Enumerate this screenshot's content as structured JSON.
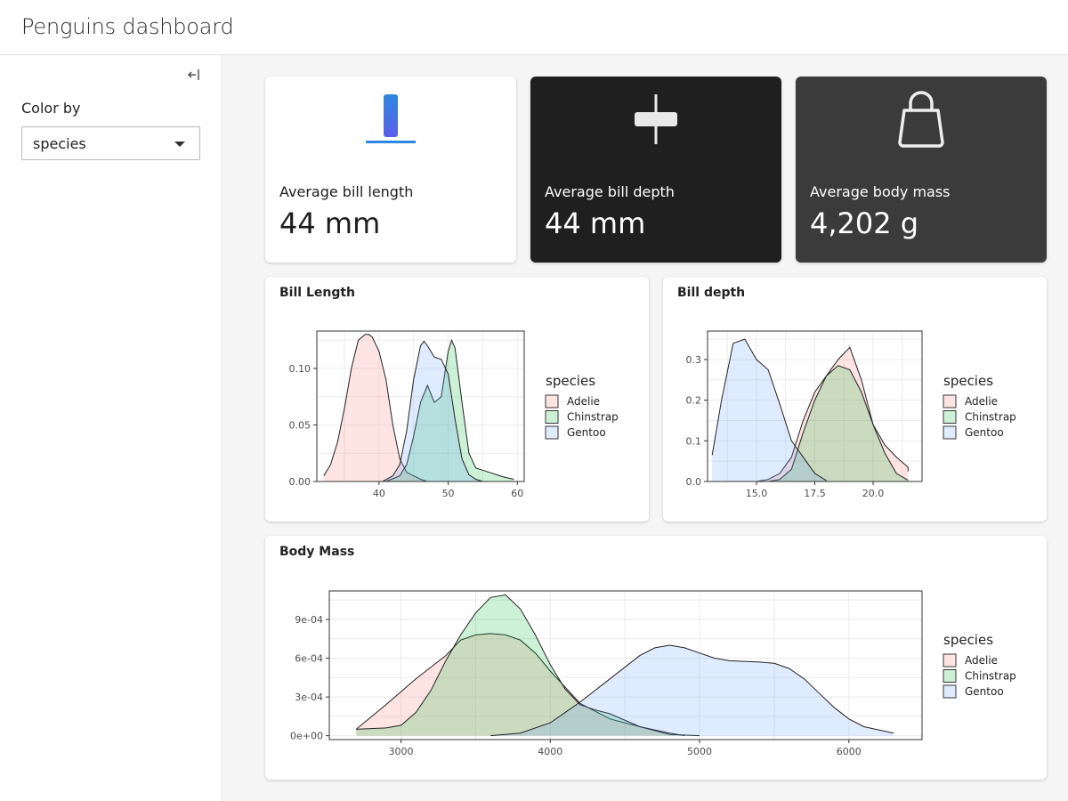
{
  "header": {
    "title": "Penguins dashboard"
  },
  "sidebar": {
    "collapse_icon": "collapse-left-icon",
    "color_by_label": "Color by",
    "color_by_value": "species"
  },
  "value_boxes": [
    {
      "title": "Average bill length",
      "value": "44 mm",
      "icon": "ruler-vertical-icon"
    },
    {
      "title": "Average bill depth",
      "value": "44 mm",
      "icon": "ruler-horizontal-icon"
    },
    {
      "title": "Average body mass",
      "value": "4,202 g",
      "icon": "shopping-bag-icon"
    }
  ],
  "colors": {
    "Adelie": "#F8766D",
    "Chinstrap": "#00BA38",
    "Gentoo": "#619CFF"
  },
  "cards": [
    {
      "title": "Bill Length"
    },
    {
      "title": "Bill depth"
    },
    {
      "title": "Body Mass"
    }
  ],
  "chart_data": [
    {
      "type": "area",
      "title": "Bill Length",
      "legend_title": "species",
      "legend": "right",
      "xlim": [
        31,
        61
      ],
      "ylim": [
        0,
        0.133
      ],
      "xticks": [
        40,
        50,
        60
      ],
      "yticks": [
        0.0,
        0.05,
        0.1
      ],
      "ytick_labels": [
        "0.00",
        "0.05",
        "0.10"
      ],
      "grid": true,
      "series": [
        {
          "name": "Adelie",
          "x": [
            32,
            33,
            34,
            35,
            36,
            37,
            38,
            38.5,
            39,
            40,
            41,
            42,
            43,
            44,
            45,
            46,
            47
          ],
          "y": [
            0.005,
            0.015,
            0.035,
            0.065,
            0.1,
            0.125,
            0.13,
            0.13,
            0.128,
            0.115,
            0.09,
            0.05,
            0.02,
            0.008,
            0.005,
            0.002,
            0
          ]
        },
        {
          "name": "Chinstrap",
          "x": [
            41,
            43,
            44,
            45,
            46,
            47,
            48,
            49,
            50,
            50.5,
            51,
            52,
            53,
            54,
            55,
            56,
            57,
            58,
            59.5
          ],
          "y": [
            0,
            0.005,
            0.015,
            0.04,
            0.07,
            0.085,
            0.07,
            0.075,
            0.115,
            0.125,
            0.118,
            0.07,
            0.025,
            0.012,
            0.01,
            0.008,
            0.006,
            0.004,
            0.002
          ]
        },
        {
          "name": "Gentoo",
          "x": [
            40.5,
            42,
            43,
            44,
            45,
            46,
            46.5,
            47,
            48,
            49,
            50,
            51,
            52,
            53,
            54,
            55
          ],
          "y": [
            0,
            0.005,
            0.015,
            0.045,
            0.09,
            0.12,
            0.124,
            0.12,
            0.11,
            0.108,
            0.095,
            0.055,
            0.02,
            0.006,
            0.002,
            0
          ]
        }
      ]
    },
    {
      "type": "area",
      "title": "Bill depth",
      "legend_title": "species",
      "legend": "right",
      "xlim": [
        12.9,
        22.1
      ],
      "ylim": [
        0,
        0.37
      ],
      "xticks": [
        15.0,
        17.5,
        20.0
      ],
      "xtick_labels": [
        "15.0",
        "17.5",
        "20.0"
      ],
      "yticks": [
        0.0,
        0.1,
        0.2,
        0.3
      ],
      "ytick_labels": [
        "0.0",
        "0.1",
        "0.2",
        "0.3"
      ],
      "grid": true,
      "series": [
        {
          "name": "Adelie",
          "x": [
            15,
            15.5,
            16,
            16.5,
            17,
            17.5,
            18,
            18.5,
            19,
            19.5,
            20,
            20.5,
            21,
            21.5,
            21.5
          ],
          "y": [
            0,
            0.005,
            0.02,
            0.06,
            0.15,
            0.22,
            0.26,
            0.3,
            0.33,
            0.25,
            0.14,
            0.09,
            0.06,
            0.035,
            0.025
          ]
        },
        {
          "name": "Chinstrap",
          "x": [
            15.5,
            16,
            16.5,
            17,
            17.5,
            18,
            18.5,
            19,
            19.5,
            20,
            20.5,
            21,
            21.5
          ],
          "y": [
            0,
            0.005,
            0.03,
            0.12,
            0.2,
            0.26,
            0.285,
            0.275,
            0.22,
            0.14,
            0.07,
            0.02,
            0.003
          ]
        },
        {
          "name": "Gentoo",
          "x": [
            13.1,
            13.5,
            14,
            14.5,
            15,
            15.5,
            16,
            16.5,
            17,
            17.5,
            18
          ],
          "y": [
            0.065,
            0.2,
            0.34,
            0.35,
            0.3,
            0.275,
            0.19,
            0.1,
            0.06,
            0.02,
            0.002
          ]
        }
      ]
    },
    {
      "type": "area",
      "title": "Body Mass",
      "legend_title": "species",
      "legend": "right",
      "xlim": [
        2520,
        6490
      ],
      "ylim": [
        -3e-05,
        0.00112
      ],
      "xticks": [
        3000,
        4000,
        5000,
        6000
      ],
      "yticks": [
        0.0,
        0.0003,
        0.0006,
        0.0009
      ],
      "ytick_labels": [
        "0e+00",
        "3e-04",
        "6e-04",
        "9e-04"
      ],
      "grid": true,
      "series": [
        {
          "name": "Adelie",
          "x": [
            2700,
            2900,
            3100,
            3300,
            3400,
            3500,
            3600,
            3700,
            3800,
            3900,
            4000,
            4200,
            4400,
            4600,
            4800,
            4900
          ],
          "y": [
            5e-05,
            0.00024,
            0.00044,
            0.00062,
            0.00074,
            0.00078,
            0.00079,
            0.00078,
            0.00074,
            0.00064,
            0.0005,
            0.00025,
            0.00013,
            7e-05,
            2e-05,
            0
          ]
        },
        {
          "name": "Chinstrap",
          "x": [
            2700,
            2900,
            3000,
            3100,
            3200,
            3300,
            3400,
            3500,
            3600,
            3700,
            3800,
            3900,
            4000,
            4100,
            4200,
            4300,
            4400,
            4600,
            4800,
            5000
          ],
          "y": [
            5e-05,
            6e-05,
            8e-05,
            0.00018,
            0.00035,
            0.00058,
            0.00078,
            0.00095,
            0.00107,
            0.00109,
            0.00098,
            0.00078,
            0.00055,
            0.00036,
            0.00024,
            0.0002,
            0.00017,
            7e-05,
            1e-05,
            0
          ]
        },
        {
          "name": "Gentoo",
          "x": [
            3600,
            3800,
            4000,
            4200,
            4400,
            4600,
            4700,
            4800,
            4900,
            5000,
            5100,
            5200,
            5400,
            5500,
            5600,
            5700,
            5800,
            5900,
            6000,
            6100,
            6300
          ],
          "y": [
            0,
            2e-05,
            0.0001,
            0.00026,
            0.00044,
            0.00062,
            0.00068,
            0.0007,
            0.00068,
            0.00064,
            0.0006,
            0.00058,
            0.00057,
            0.00056,
            0.00052,
            0.00044,
            0.00033,
            0.00022,
            0.00013,
            7e-05,
            2e-05
          ]
        }
      ]
    }
  ]
}
